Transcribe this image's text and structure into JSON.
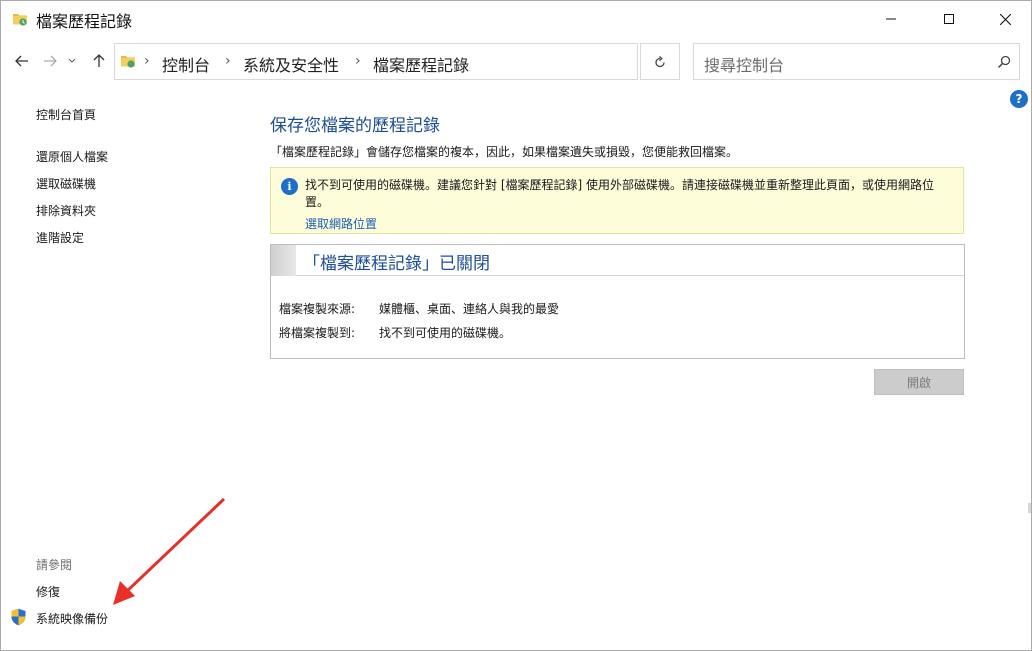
{
  "window": {
    "title": "檔案歷程記錄"
  },
  "address": {
    "breadcrumbs": [
      "控制台",
      "系統及安全性",
      "檔案歷程記錄"
    ],
    "separator": "›",
    "search_placeholder": "搜尋控制台"
  },
  "help": {
    "label": "?"
  },
  "left_nav": {
    "home": "控制台首頁",
    "items": [
      "還原個人檔案",
      "選取磁碟機",
      "排除資料夾",
      "進階設定"
    ],
    "see_also_label": "請參閱",
    "see_also": [
      "修復",
      "系統映像備份"
    ]
  },
  "main": {
    "title": "保存您檔案的歷程記錄",
    "description": "「檔案歷程記錄」會儲存您檔案的複本，因此，如果檔案遺失或損毀，您便能救回檔案。",
    "info": {
      "icon_glyph": "i",
      "text": "找不到可使用的磁碟機。建議您針對 [檔案歷程記錄] 使用外部磁碟機。請連接磁碟機並重新整理此頁面，或使用網路位置。",
      "link": "選取網路位置"
    },
    "status_panel": {
      "title": "「檔案歷程記錄」已關閉",
      "copy_from_label": "檔案複製來源:",
      "copy_from_value": "媒體櫃、桌面、連絡人與我的最愛",
      "copy_to_label": "將檔案複製到:",
      "copy_to_value": "找不到可使用的磁碟機。"
    },
    "turn_on_button": "開啟"
  },
  "colors": {
    "accent": "#1d4e96",
    "link": "#1d5fb8",
    "info_bg": "#fdfdd9",
    "arrow": "#e8302a"
  }
}
